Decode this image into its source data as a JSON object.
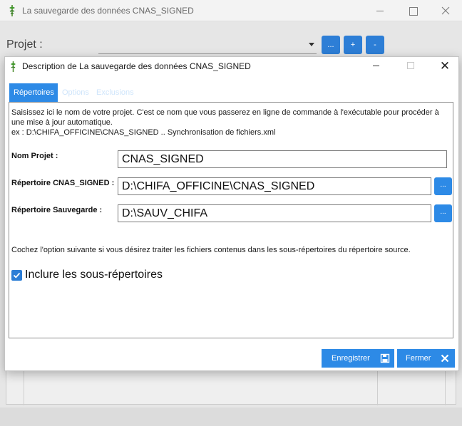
{
  "main_window": {
    "title": "La sauvegarde des données CNAS_SIGNED",
    "projet_label": "Projet :",
    "projet_value": "",
    "buttons": {
      "browse": "...",
      "add": "+",
      "remove": "-"
    }
  },
  "dialog": {
    "title": "Description de La sauvegarde des données CNAS_SIGNED",
    "close_glyph": "✕",
    "tabs": [
      {
        "label": "Répertoires",
        "active": true
      },
      {
        "label": "Options",
        "active": false
      },
      {
        "label": "Exclusions",
        "active": false
      }
    ],
    "description_line1": "Saisissez ici le nom de votre projet. C'est ce nom que vous passerez en ligne de commande à l'exécutable pour procéder à une mise à jour automatique.",
    "description_example": "ex : D:\\CHIFA_OFFICINE\\CNAS_SIGNED .. Synchronisation de fichiers.xml",
    "fields": {
      "nom_projet": {
        "label": "Nom Projet :",
        "value": "CNAS_SIGNED"
      },
      "repertoire_source": {
        "label": "Répertoire CNAS_SIGNED :",
        "value": "D:\\CHIFA_OFFICINE\\CNAS_SIGNED",
        "browse": "..."
      },
      "repertoire_sauvegarde": {
        "label": "Répertoire Sauvegarde :",
        "value": "D:\\SAUV_CHIFA",
        "browse": "..."
      }
    },
    "option_text": "Cochez l'option suivante si vous désirez traiter les fichiers contenus dans les sous-répertoires du répertoire source.",
    "checkbox": {
      "label": "Inclure les sous-répertoires",
      "checked": true
    },
    "buttons": {
      "save": {
        "label": "Enregistrer",
        "icon": "floppy-disk-icon"
      },
      "close": {
        "label": "Fermer",
        "icon": "close-x-icon"
      }
    }
  },
  "colors": {
    "accent": "#2d8ae6",
    "accent_dark": "#2d7ed6",
    "background": "#e6e6e6"
  }
}
